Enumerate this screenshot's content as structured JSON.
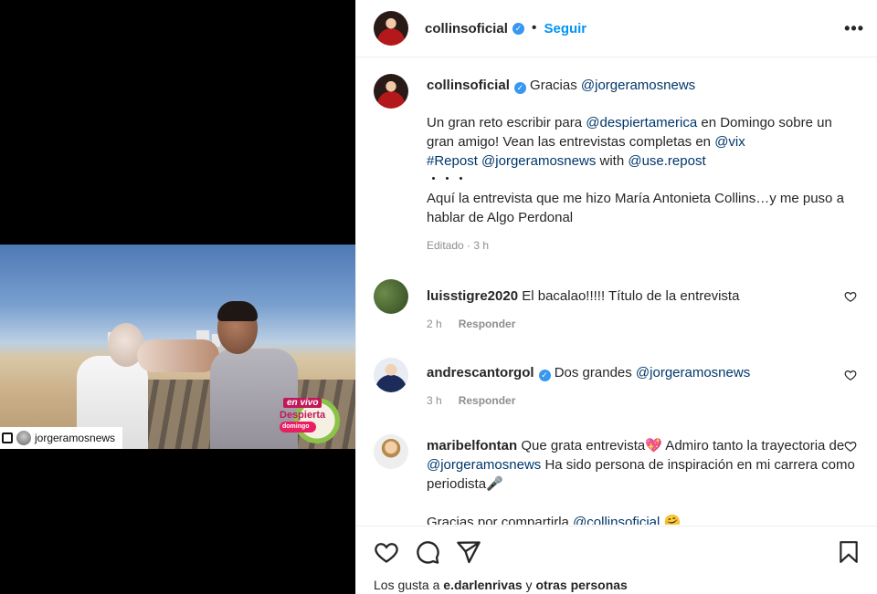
{
  "post": {
    "username": "collinsoficial",
    "follow_label": "Seguir",
    "more_label": "•••",
    "media_tag": "jorgeramosnews",
    "live_badge": "en vivo",
    "live_logo": "Despierta",
    "live_logo_sub": "domingo"
  },
  "caption": {
    "username": "collinsoficial",
    "line1_pre": "Gracias ",
    "mention1": "@jorgeramosnews",
    "p2_a": "Un gran reto escribir para ",
    "mention2": "@despiertamerica",
    "p2_b": " en Domingo sobre un gran amigo! Vean las entrevistas completas en ",
    "mention3": "@vix",
    "hashtag": "#Repost",
    "mention4": "@jorgeramosnews",
    "with_text": " with ",
    "mention5": "@use.repost",
    "dots": "・・・",
    "p3": "Aquí la entrevista que me hizo María Antonieta Collins…y me puso a hablar de Algo Perdonal",
    "meta": "Editado · 3 h"
  },
  "comments": [
    {
      "user": "luisstigre2020",
      "text": "El bacalao!!!!! Título de la entrevista",
      "time": "2 h",
      "reply": "Responder"
    },
    {
      "user": "andrescantorgol",
      "text_pre": "Dos grandes ",
      "mention": "@jorgeramosnews",
      "time": "3 h",
      "reply": "Responder"
    },
    {
      "user": "maribelfontan",
      "text_a": "Que grata entrevista",
      "emoji_heart": "💖",
      "text_b": " Admiro tanto la trayectoria de ",
      "mention": "@jorgeramosnews",
      "text_c": " Ha sido persona de inspiración en mi carrera como periodista",
      "emoji_mic": "🎤",
      "text_d": "Gracias por compartirla ",
      "mention2": "@collinsoficial",
      "emoji_hug": "🤗"
    }
  ],
  "likes": {
    "prefix": "Los gusta a ",
    "user": "e.darlenrivas",
    "mid": " y ",
    "others": "otras personas"
  },
  "colors": {
    "link": "#00376b",
    "follow": "#0095f6",
    "verified": "#3897f0"
  }
}
